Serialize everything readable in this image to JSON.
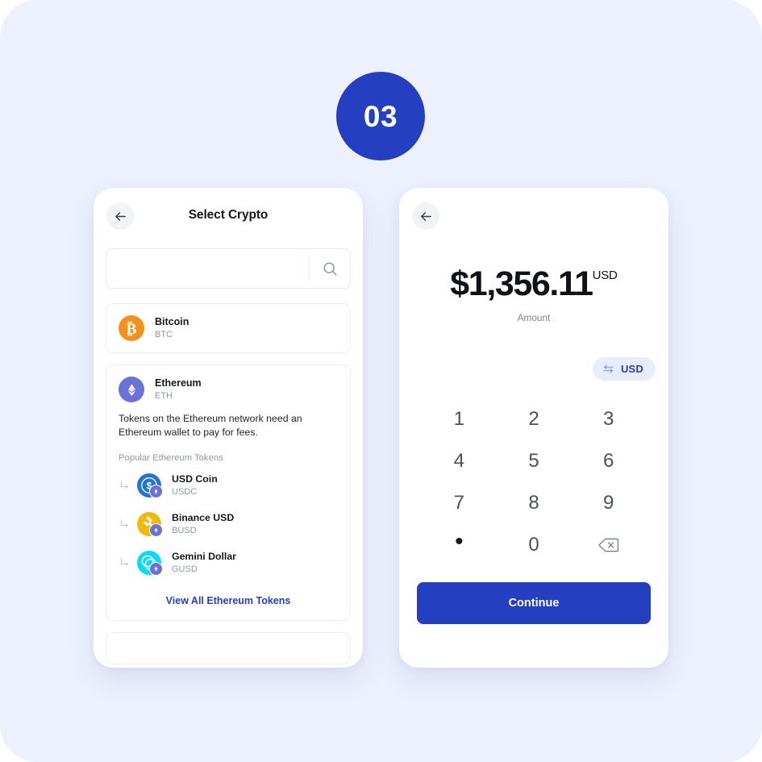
{
  "step": {
    "number": "03"
  },
  "colors": {
    "background": "#edf0fd",
    "accent_blue": "#2440c0",
    "chip_bg": "#e9ecfb",
    "bitcoin_orange": "#f2921d",
    "ethereum_indigo": "#6a72d8",
    "usdc_blue": "#2775ca",
    "busd_yellow": "#f0b90b",
    "gusd_cyan": "#00dcfa",
    "muted_text": "#9297a6"
  },
  "select_crypto_screen": {
    "back_label": "Back",
    "title": "Select Crypto",
    "search": {
      "value": "",
      "placeholder": "",
      "icon": "search-icon"
    },
    "coins": [
      {
        "name": "Bitcoin",
        "ticker": "BTC",
        "icon": "bitcoin-icon",
        "symbol": "₿"
      },
      {
        "name": "Ethereum",
        "ticker": "ETH",
        "icon": "ethereum-icon"
      }
    ],
    "ethereum_note": "Tokens on the Ethereum network need an Ethereum wallet to pay for fees.",
    "tokens_label": "Popular Ethereum Tokens",
    "tokens": [
      {
        "name": "USD Coin",
        "ticker": "USDC",
        "icon": "usd-coin-icon"
      },
      {
        "name": "Binance USD",
        "ticker": "BUSD",
        "icon": "binance-usd-icon"
      },
      {
        "name": "Gemini Dollar",
        "ticker": "GUSD",
        "icon": "gemini-dollar-icon"
      }
    ],
    "view_all_label": "View All Ethereum Tokens"
  },
  "amount_screen": {
    "back_label": "Back",
    "amount_value": "$1,356.11",
    "amount_currency": "USD",
    "amount_caption": "Amount",
    "switch_chip": {
      "label": "USD",
      "icon": "swap-arrows-icon"
    },
    "keypad": [
      {
        "key": "1",
        "type": "digit"
      },
      {
        "key": "2",
        "type": "digit"
      },
      {
        "key": "3",
        "type": "digit"
      },
      {
        "key": "4",
        "type": "digit"
      },
      {
        "key": "5",
        "type": "digit"
      },
      {
        "key": "6",
        "type": "digit"
      },
      {
        "key": "7",
        "type": "digit"
      },
      {
        "key": "8",
        "type": "digit"
      },
      {
        "key": "9",
        "type": "digit"
      },
      {
        "key": "•",
        "type": "decimal"
      },
      {
        "key": "0",
        "type": "digit"
      },
      {
        "key": "",
        "type": "backspace"
      }
    ],
    "continue_label": "Continue"
  }
}
